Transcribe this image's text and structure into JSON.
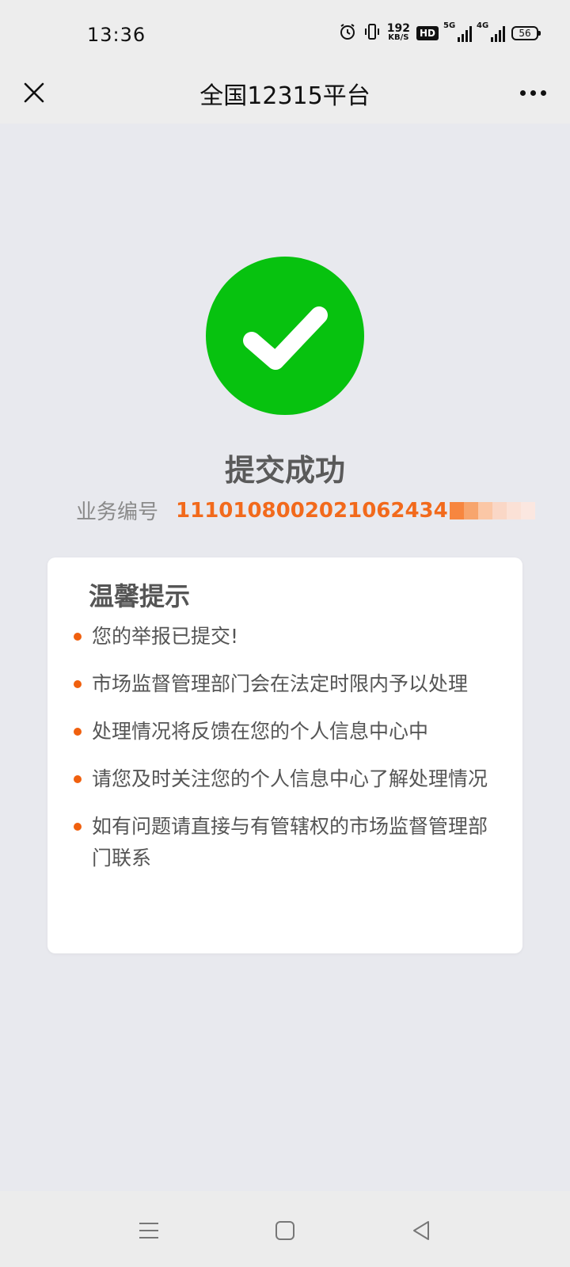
{
  "status_bar": {
    "time": "13:36",
    "speed_value": "192",
    "speed_unit": "KB/S",
    "hd_label": "HD",
    "signal_1_label": "5G",
    "signal_2_label": "4G",
    "battery": "56"
  },
  "nav": {
    "title": "全国12315平台"
  },
  "result": {
    "title": "提交成功",
    "business_label": "业务编号",
    "business_number": "1110108002021062434",
    "mosaic_colors": [
      "#f7863f",
      "#f7a56d",
      "#fbc7a6",
      "#fad7c6",
      "#fbe1d6",
      "#fbe7e0"
    ]
  },
  "tips": {
    "title": "温馨提示",
    "items": [
      "您的举报已提交!",
      "市场监督管理部门会在法定时限内予以处理",
      "处理情况将反馈在您的个人信息中心中",
      "请您及时关注您的个人信息中心了解处理情况",
      "如有问题请直接与有管辖权的市场监督管理部门联系"
    ]
  },
  "colors": {
    "success_green": "#07c20f",
    "accent_orange": "#f26a1c",
    "page_background": "#e8e9ee"
  },
  "icons": {
    "close": "close-icon",
    "more": "more-icon",
    "success": "checkmark-icon",
    "menu": "menu-icon",
    "home": "home-icon",
    "back": "back-icon"
  }
}
